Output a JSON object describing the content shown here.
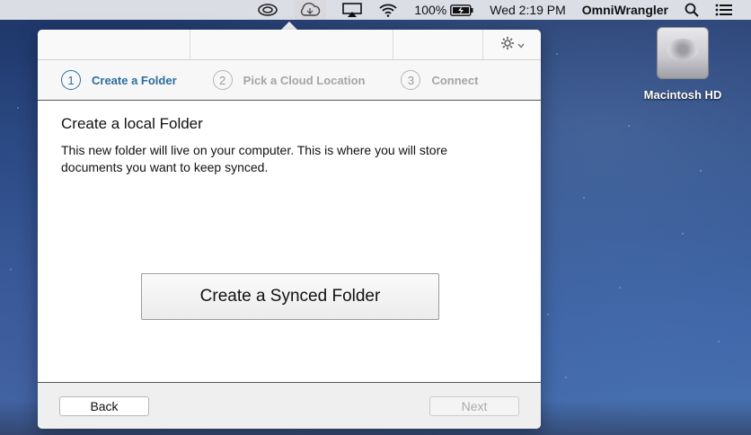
{
  "menubar": {
    "battery": "100%",
    "clock": "Wed 2:19 PM",
    "app_name": "OmniWrangler",
    "icons": [
      "creative-cloud-icon",
      "cloud-sync-icon",
      "airplay-icon",
      "wifi-icon",
      "battery-icon",
      "search-icon",
      "list-icon"
    ]
  },
  "desktop": {
    "drive_label": "Macintosh HD"
  },
  "steps": [
    {
      "number": "1",
      "label": "Create a Folder"
    },
    {
      "number": "2",
      "label": "Pick a Cloud Location"
    },
    {
      "number": "3",
      "label": "Connect"
    }
  ],
  "content": {
    "heading": "Create a local Folder",
    "description": "This new folder will live on your computer. This is where you will store documents you want to keep synced.",
    "primary_button": "Create a Synced Folder"
  },
  "footer": {
    "back_label": "Back",
    "next_label": "Next"
  },
  "colors": {
    "accent": "#2b6d9e",
    "inactive": "#a5a5a5"
  }
}
